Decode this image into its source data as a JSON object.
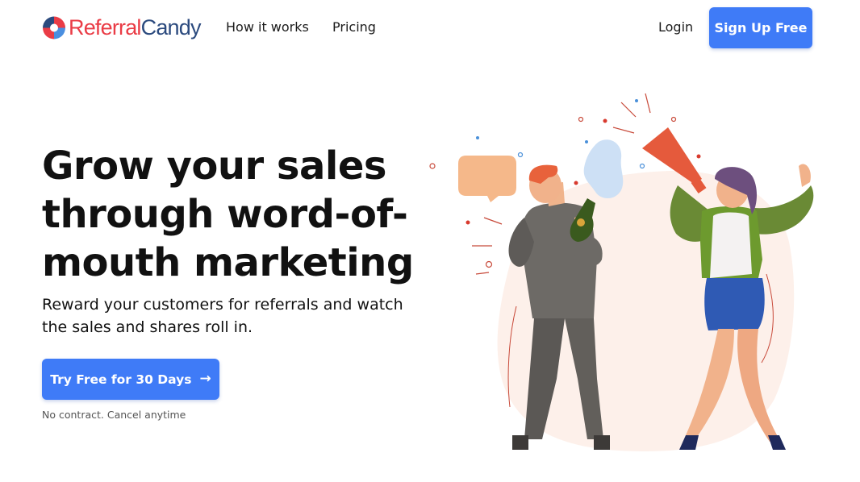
{
  "header": {
    "logo": {
      "part1": "Referral",
      "part2": "Candy"
    },
    "nav": [
      {
        "label": "How it works"
      },
      {
        "label": "Pricing"
      }
    ],
    "login_label": "Login",
    "signup_label": "Sign Up Free"
  },
  "hero": {
    "title": "Grow your sales through word-of-mouth marketing",
    "subtitle": "Reward your customers for referrals and watch the sales and shares roll in.",
    "cta_label": "Try Free for 30 Days",
    "cta_icon": "arrow-right-icon",
    "note": "No contract. Cancel anytime"
  },
  "colors": {
    "accent": "#3f7bf7",
    "logo_red": "#ea3c46",
    "logo_navy": "#2b4a7e"
  }
}
